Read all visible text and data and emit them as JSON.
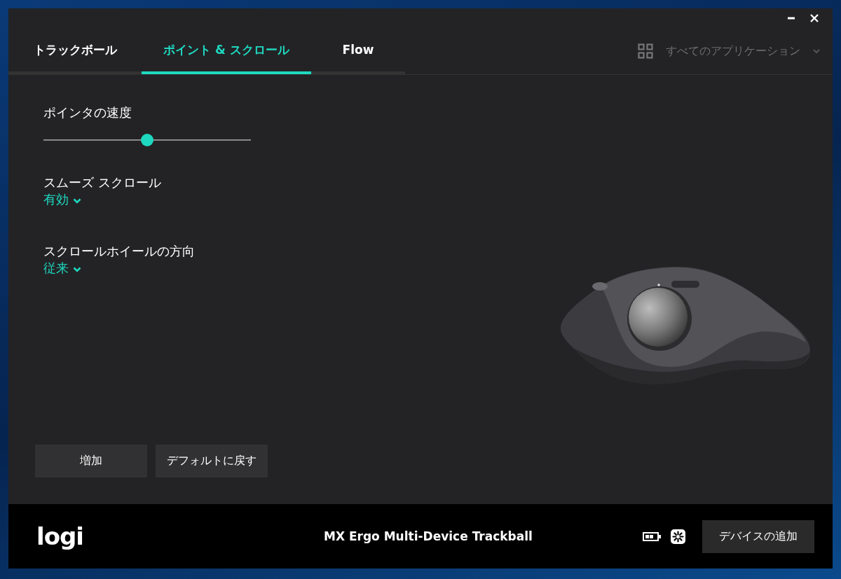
{
  "tabs": [
    {
      "label": "トラックボール",
      "selected": false
    },
    {
      "label": "ポイント & スクロール",
      "selected": true
    },
    {
      "label": "Flow",
      "selected": false
    }
  ],
  "app_selector": {
    "label": "すべてのアプリケーション"
  },
  "pointer_speed": {
    "label": "ポインタの速度",
    "level": 0.5
  },
  "settings": [
    {
      "label": "スムーズ スクロール",
      "value": "有効"
    },
    {
      "label": "スクロールホイールの方向",
      "value": "従来"
    }
  ],
  "buttons": [
    "増加",
    "デフォルトに戻す"
  ],
  "footer": {
    "logo": "logi",
    "device_name": "MX Ergo Multi-Device Trackball",
    "add_device_button": "デバイスの追加"
  }
}
